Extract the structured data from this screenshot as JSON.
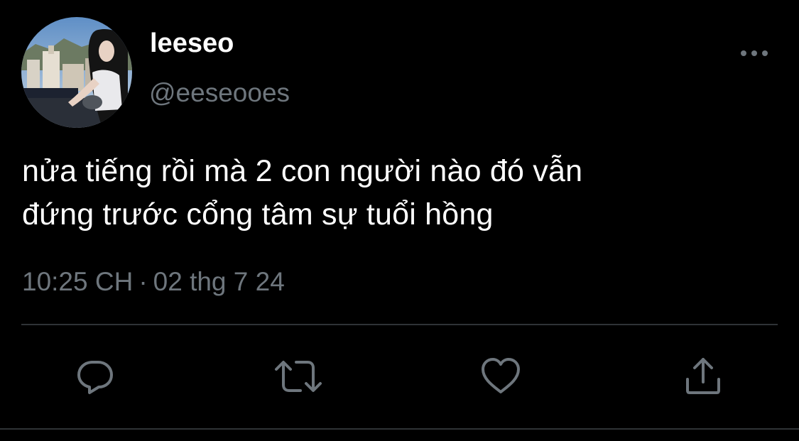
{
  "tweet": {
    "author": {
      "display_name": "leeseo",
      "handle": "@eeseooes",
      "avatar_icon": "profile-photo"
    },
    "text_lines": [
      "nửa tiếng rồi mà 2 con người nào đó vẫn",
      "đứng trước cổng tâm sự tuổi hồng"
    ],
    "time": "10:25 CH",
    "separator": "·",
    "date": "02 thg 7 24"
  },
  "actions": [
    {
      "icon": "reply-icon"
    },
    {
      "icon": "retweet-icon"
    },
    {
      "icon": "like-icon"
    },
    {
      "icon": "share-icon"
    }
  ],
  "colors": {
    "background": "#000000",
    "primary_text": "#ffffff",
    "secondary_text": "#6e767d",
    "divider": "#2f3336"
  }
}
